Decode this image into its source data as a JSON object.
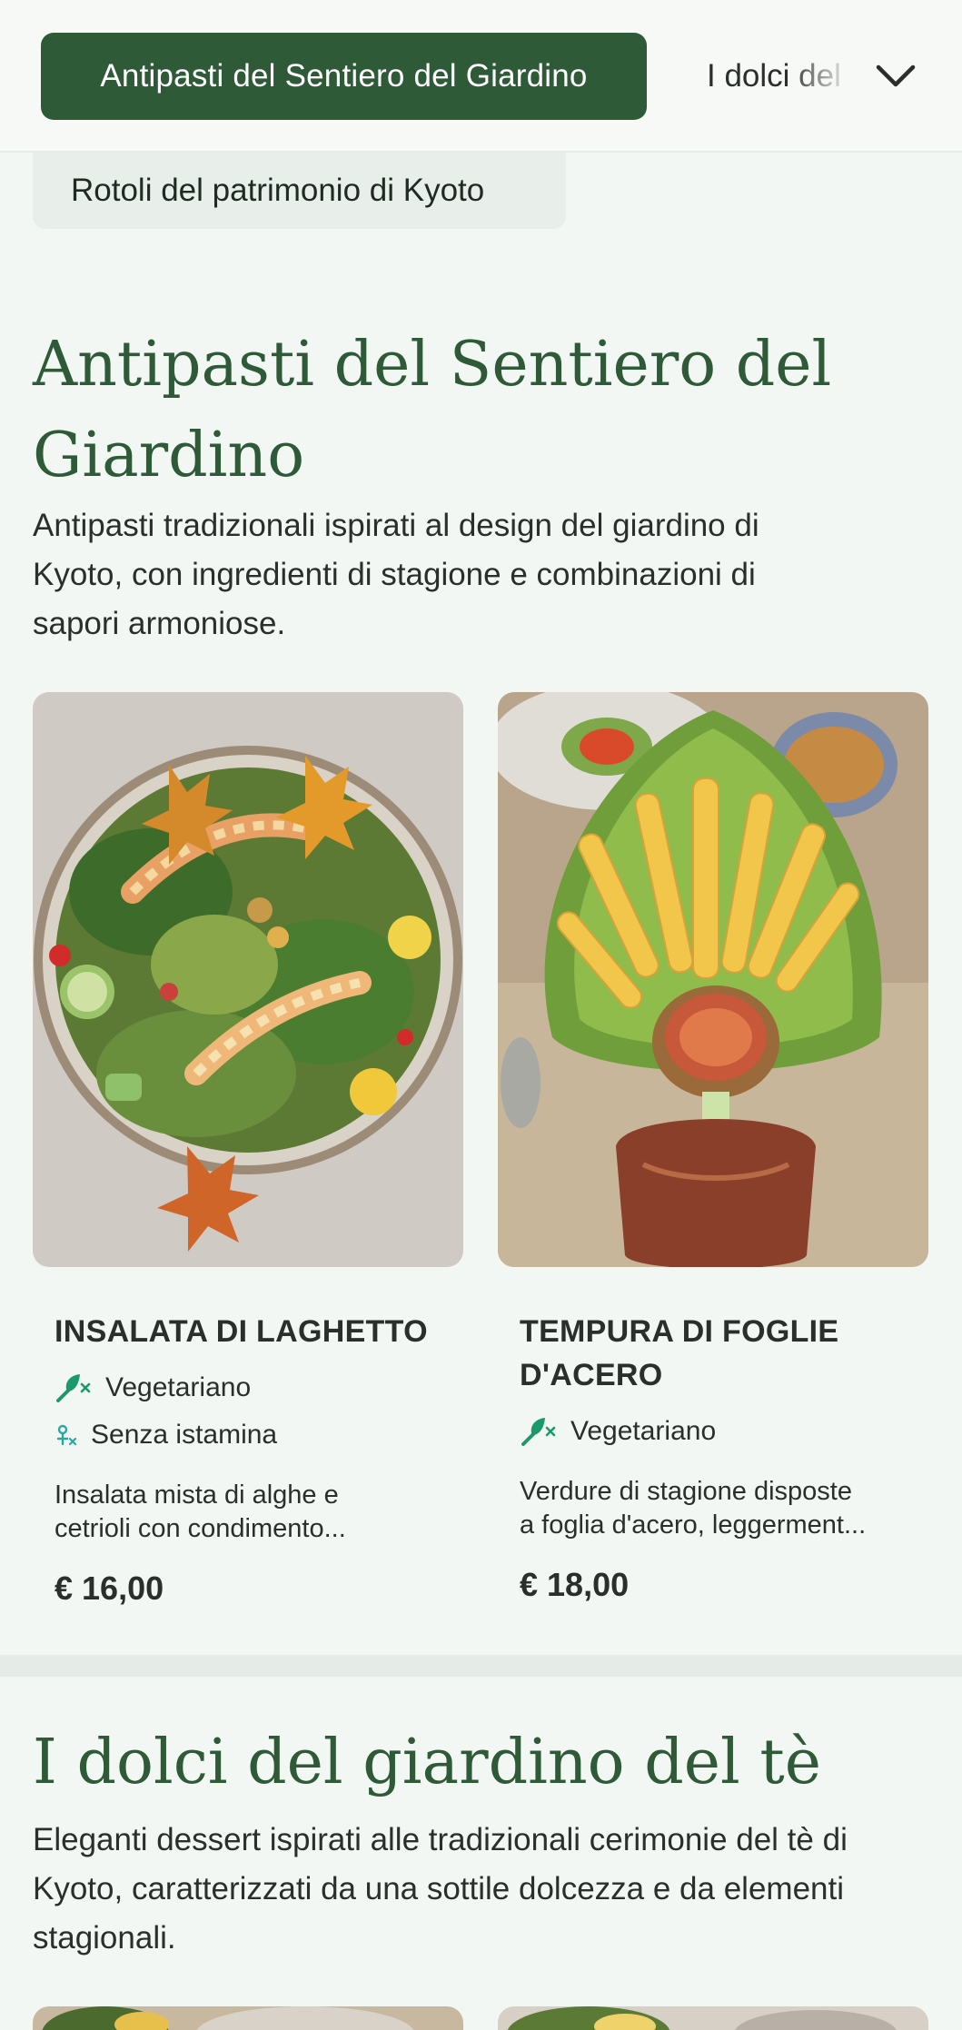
{
  "nav": {
    "active_category": "Antipasti del Sentiero del Giardino",
    "next_category": "I dolci del giardino del tè",
    "second_row_category": "Rotoli del patrimonio di Kyoto"
  },
  "sections": [
    {
      "title_line1": "Antipasti del Sentiero del",
      "title_line2": "Giardino",
      "description_lines": [
        "Antipasti tradizionali ispirati al design del giardino di",
        "Kyoto, con ingredienti di stagione e combinazioni di",
        "sapori armoniose."
      ],
      "items": [
        {
          "name": "INSALATA DI LAGHETTO",
          "tags": [
            "Vegetariano",
            "Senza istamina"
          ],
          "desc_lines": [
            "Insalata mista di alghe e",
            "cetrioli con condimento..."
          ],
          "price": "€ 16,00"
        },
        {
          "name_line1": "TEMPURA DI FOGLIE",
          "name_line2": "D'ACERO",
          "tags": [
            "Vegetariano"
          ],
          "desc_lines": [
            "Verdure di stagione disposte",
            "a foglia d'acero, leggerment..."
          ],
          "price": "€ 18,00"
        }
      ]
    },
    {
      "title": "I dolci del giardino del tè",
      "description_lines": [
        "Eleganti dessert ispirati alle tradizionali cerimonie del tè di",
        "Kyoto, caratterizzati da una sottile dolcezza e da elementi",
        "stagionali."
      ]
    }
  ],
  "colors": {
    "accent": "#2f5a38",
    "background": "#f3f7f3",
    "tag_icon": "#1a9a6a"
  },
  "icons": [
    "chevron-down-icon",
    "vegetarian-icon",
    "histamine-free-icon"
  ]
}
